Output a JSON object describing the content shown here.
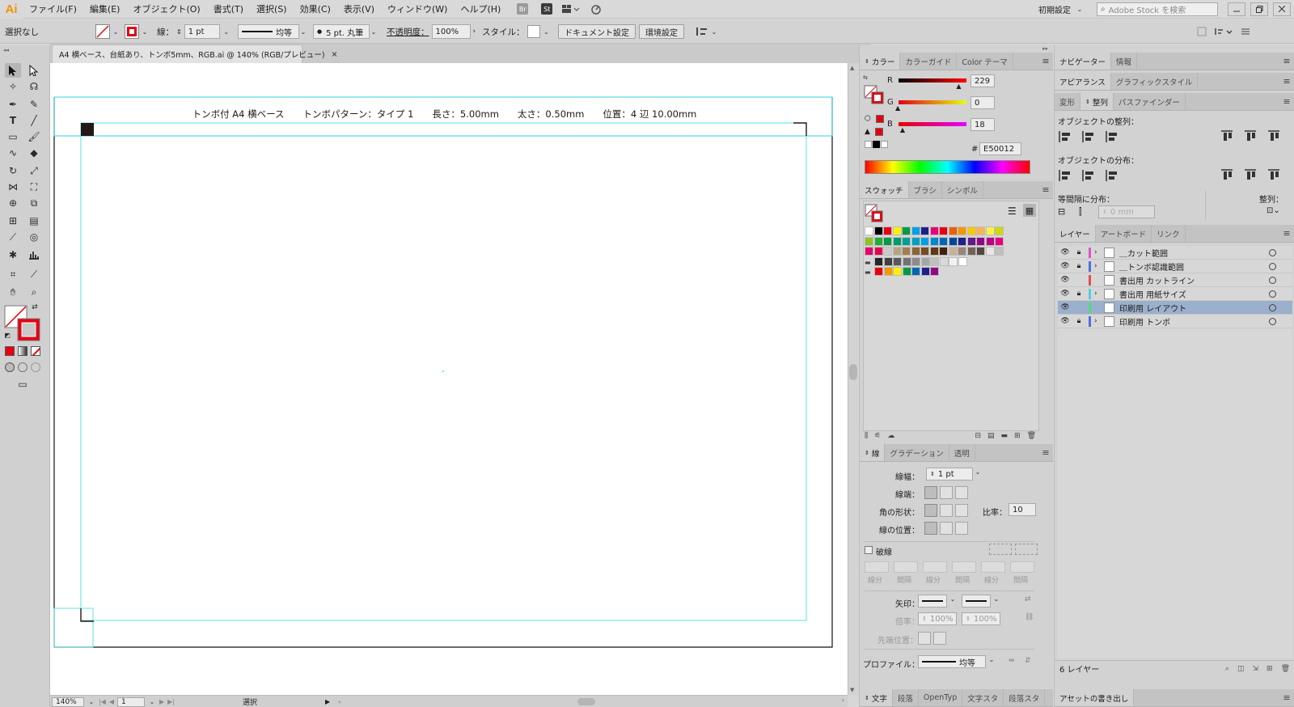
{
  "app": {
    "logo": "Ai"
  },
  "menu": [
    "ファイル(F)",
    "編集(E)",
    "オブジェクト(O)",
    "書式(T)",
    "選択(S)",
    "効果(C)",
    "表示(V)",
    "ウィンドウ(W)",
    "ヘルプ(H)"
  ],
  "menubar_icons": {
    "br": "Br",
    "st": "St"
  },
  "workspace": {
    "label": "初期設定",
    "search_placeholder": "Adobe Stock を検索"
  },
  "control": {
    "selection": "選択なし",
    "stroke_label": "線：",
    "stroke_weight": "1 pt",
    "profile": "均等",
    "brush": "5 pt. 丸筆",
    "opacity_label": "不透明度：",
    "opacity": "100%",
    "style_label": "スタイル：",
    "doc_setup": "ドキュメント設定",
    "prefs": "環境設定"
  },
  "document": {
    "tab_title": "A4 横ベース、台紙あり、トンボ5mm、RGB.ai @ 140% (RGB/プレビュー)",
    "close": "×",
    "header_text": "トンボ付 A4 横ベース　　トンボパターン：タイプ 1　　長さ：5.00mm　　太さ：0.50mm　　位置：4 辺 10.00mm"
  },
  "status": {
    "zoom": "140%",
    "page": "1",
    "mode": "選択"
  },
  "color_panel": {
    "tabs": [
      "カラー",
      "カラーガイド",
      "Color テーマ"
    ],
    "r_label": "R",
    "g_label": "G",
    "b_label": "B",
    "r": "229",
    "g": "0",
    "b": "18",
    "r_level": 229,
    "g_level": 0,
    "b_level": 18,
    "hash": "#",
    "hex": "E50012",
    "fill_color": "#e50012"
  },
  "swatch_panel": {
    "tabs": [
      "スウォッチ",
      "ブラシ",
      "シンボル"
    ],
    "colors": [
      [
        "#ffffff",
        "#000000",
        "#e50012",
        "#fff100",
        "#009944",
        "#00a0e9",
        "#1d2088",
        "#e4007f",
        "#e60012",
        "#eb6100",
        "#f39800",
        "#fcc800",
        "#f8b551",
        "#fff33f",
        "#cfdb00"
      ],
      [
        "#8fc31f",
        "#22ac38",
        "#009944",
        "#009b6b",
        "#009e96",
        "#00a0c1",
        "#00a0e9",
        "#0086d1",
        "#0068b7",
        "#00479d",
        "#1d2088",
        "#601986",
        "#920783",
        "#be0081",
        "#e4007f"
      ],
      [
        "#e5006a",
        "#e5004f",
        "#c9caca",
        "#b4a582",
        "#a67c52",
        "#8c6239",
        "#754c24",
        "#603813",
        "#42210b",
        "#c7b299",
        "#998675",
        "#736357",
        "#534741",
        "#e6e6e6",
        "#bfbfbf"
      ],
      [
        "#262626",
        "#404040",
        "#595959",
        "#737373",
        "#8c8c8c",
        "#a6a6a6",
        "#bfbfbf",
        "#d9d9d9",
        "#f2f2f2",
        "#ffffff"
      ],
      [
        "#e60012",
        "#f39800",
        "#fff100",
        "#009944",
        "#0068b7",
        "#1d2088",
        "#920783"
      ]
    ]
  },
  "stroke_panel": {
    "tabs": [
      "線",
      "グラデーション",
      "透明"
    ],
    "weight_label": "線幅：",
    "weight": "1 pt",
    "cap_label": "線端：",
    "corner_label": "角の形状：",
    "limit_label": "比率：",
    "limit": "10",
    "align_label": "線の位置：",
    "dashed": "破線",
    "dash_labels": [
      "線分",
      "間隔",
      "線分",
      "間隔",
      "線分",
      "間隔"
    ],
    "arrow_label": "矢印：",
    "scale_label": "倍率：",
    "scale1": "100%",
    "scale2": "100%",
    "tip_label": "先端位置：",
    "profile_label": "プロファイル：",
    "profile": "均等"
  },
  "bottom_tabs": [
    "文字",
    "段落",
    "OpenTyp",
    "文字スタ",
    "段落スタ"
  ],
  "nav_panel": {
    "tabs": [
      "ナビゲーター",
      "情報"
    ]
  },
  "appearance_panel": {
    "tabs": [
      "アピアランス",
      "グラフィックスタイル"
    ]
  },
  "align_panel": {
    "tabs": [
      "変形",
      "整列",
      "パスファインダー"
    ],
    "align_objects": "オブジェクトの整列：",
    "distribute_objects": "オブジェクトの分布：",
    "distribute_spacing": "等間隔に分布：",
    "align_to": "整列：",
    "spacing": "0 mm"
  },
  "layers_panel": {
    "tabs": [
      "レイヤー",
      "アートボード",
      "リンク"
    ],
    "layers": [
      {
        "name": "＿カット範囲",
        "color": "#e04fd0",
        "locked": true,
        "expand": true,
        "selected": false
      },
      {
        "name": "＿トンボ認識範囲",
        "color": "#4f6fe0",
        "locked": true,
        "expand": true,
        "selected": false
      },
      {
        "name": "書出用 カットライン",
        "color": "#e04f4f",
        "locked": false,
        "expand": false,
        "selected": false
      },
      {
        "name": "書出用 用紙サイズ",
        "color": "#4fd0e0",
        "locked": true,
        "expand": true,
        "selected": false
      },
      {
        "name": "印刷用 レイアウト",
        "color": "#4fe06f",
        "locked": false,
        "expand": false,
        "selected": true
      },
      {
        "name": "印刷用 トンボ",
        "color": "#4f6fe0",
        "locked": true,
        "expand": true,
        "selected": false
      }
    ],
    "count": "6 レイヤー"
  },
  "asset_export": "アセットの書き出し"
}
